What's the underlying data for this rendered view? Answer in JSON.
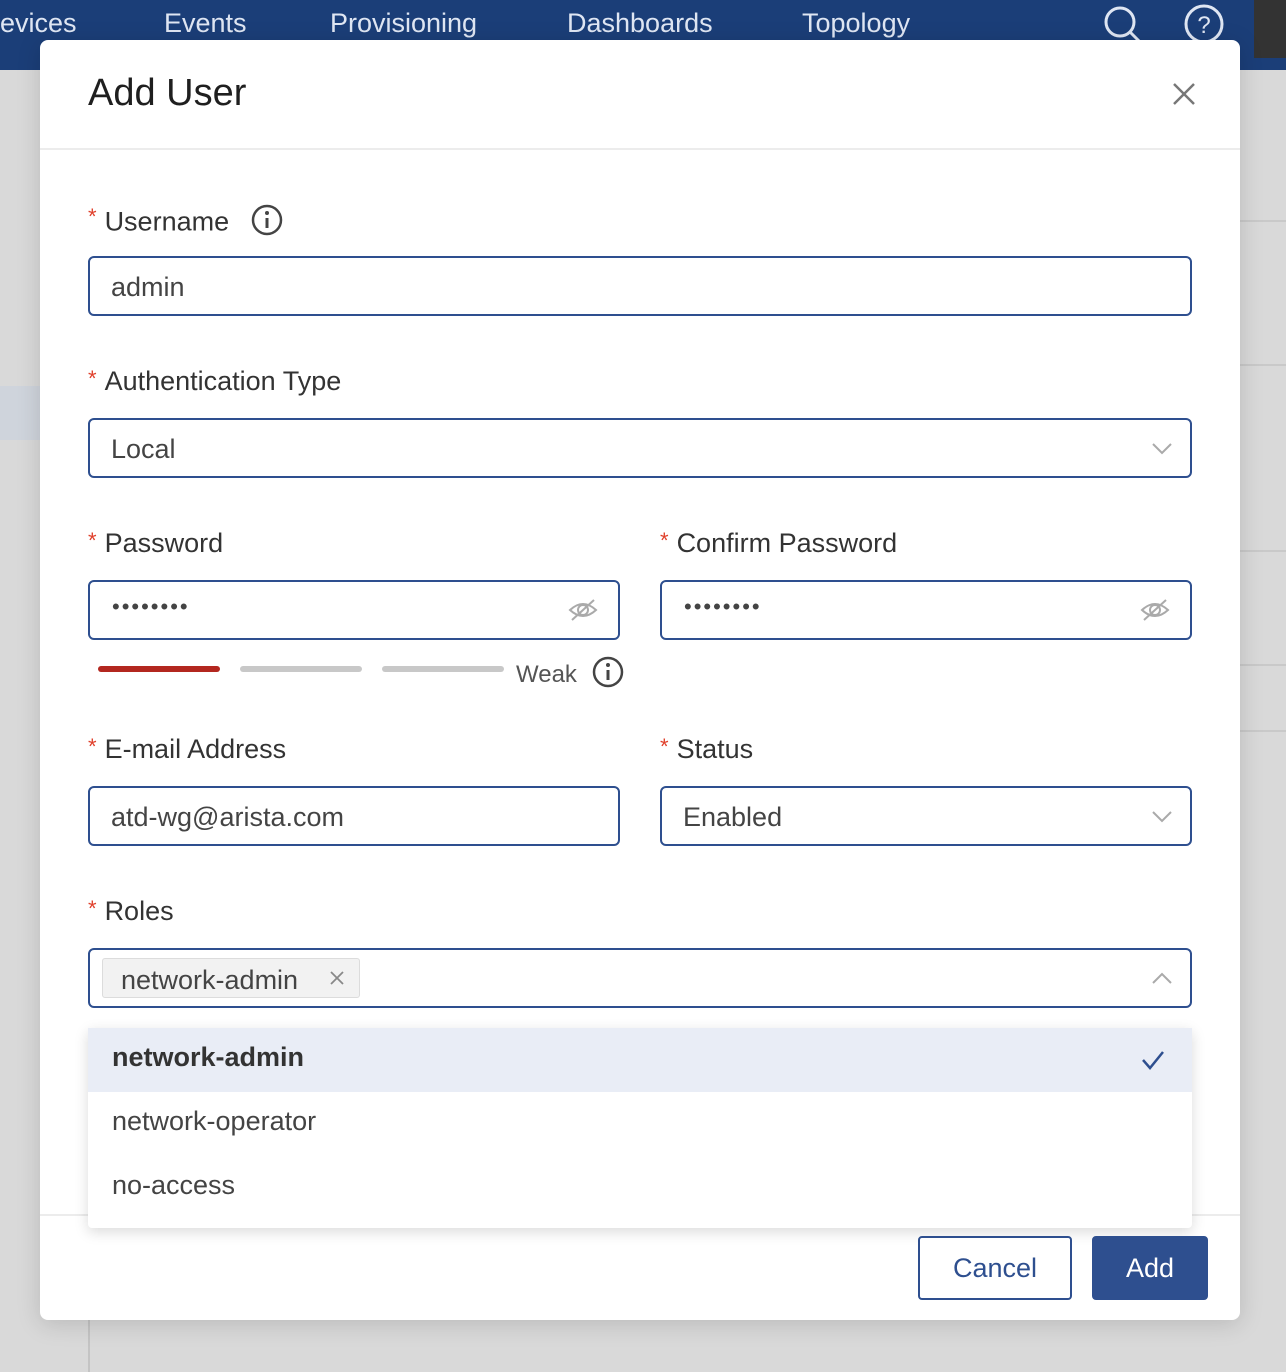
{
  "nav": {
    "items": [
      "evices",
      "Events",
      "Provisioning",
      "Dashboards",
      "Topology"
    ],
    "search_icon": "search-icon",
    "help_icon": "help-icon"
  },
  "modal": {
    "title": "Add User",
    "close_icon": "close-icon"
  },
  "form": {
    "username": {
      "label": "Username",
      "value": "admin",
      "info_icon": "info-icon"
    },
    "auth_type": {
      "label": "Authentication Type",
      "value": "Local"
    },
    "password": {
      "label": "Password",
      "value": "••••••••",
      "strength": "Weak",
      "strength_level": 0.33
    },
    "confirm_password": {
      "label": "Confirm Password",
      "value": "••••••••"
    },
    "email": {
      "label": "E-mail Address",
      "value": "atd-wg@arista.com"
    },
    "status": {
      "label": "Status",
      "value": "Enabled"
    },
    "roles": {
      "label": "Roles",
      "selected_tags": [
        "network-admin"
      ],
      "options": [
        {
          "label": "network-admin",
          "selected": true
        },
        {
          "label": "network-operator",
          "selected": false
        },
        {
          "label": "no-access",
          "selected": false
        }
      ]
    },
    "required_marker": "*"
  },
  "footer": {
    "cancel_label": "Cancel",
    "add_label": "Add"
  },
  "colors": {
    "nav_bg": "#1b3e78",
    "primary": "#2e4f8f",
    "required": "#e0402b",
    "strength_weak": "#b3271f"
  }
}
